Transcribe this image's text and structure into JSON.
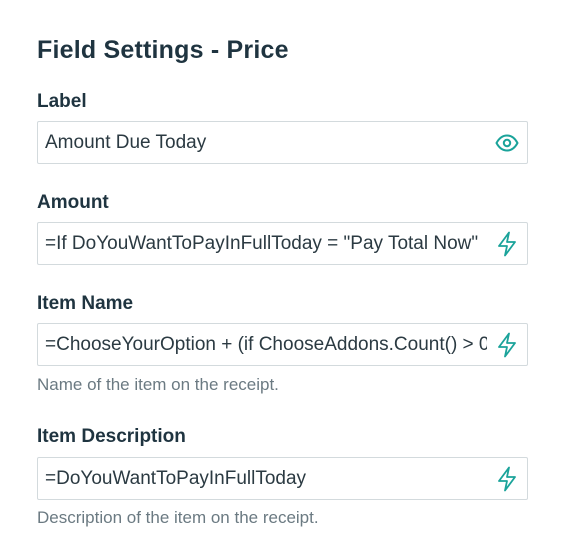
{
  "page_title": "Field Settings - Price",
  "accent_color": "#1aa39a",
  "fields": [
    {
      "label": "Label",
      "value": "Amount Due Today",
      "icon": "eye-icon",
      "help": ""
    },
    {
      "label": "Amount",
      "value": "=If DoYouWantToPayInFullToday = \"Pay Total Now\"",
      "icon": "lightning-icon",
      "help": ""
    },
    {
      "label": "Item Name",
      "value": "=ChooseYourOption + (if ChooseAddons.Count() > 0",
      "icon": "lightning-icon",
      "help": "Name of the item on the receipt."
    },
    {
      "label": "Item Description",
      "value": "=DoYouWantToPayInFullToday",
      "icon": "lightning-icon",
      "help": "Description of the item on the receipt."
    }
  ]
}
